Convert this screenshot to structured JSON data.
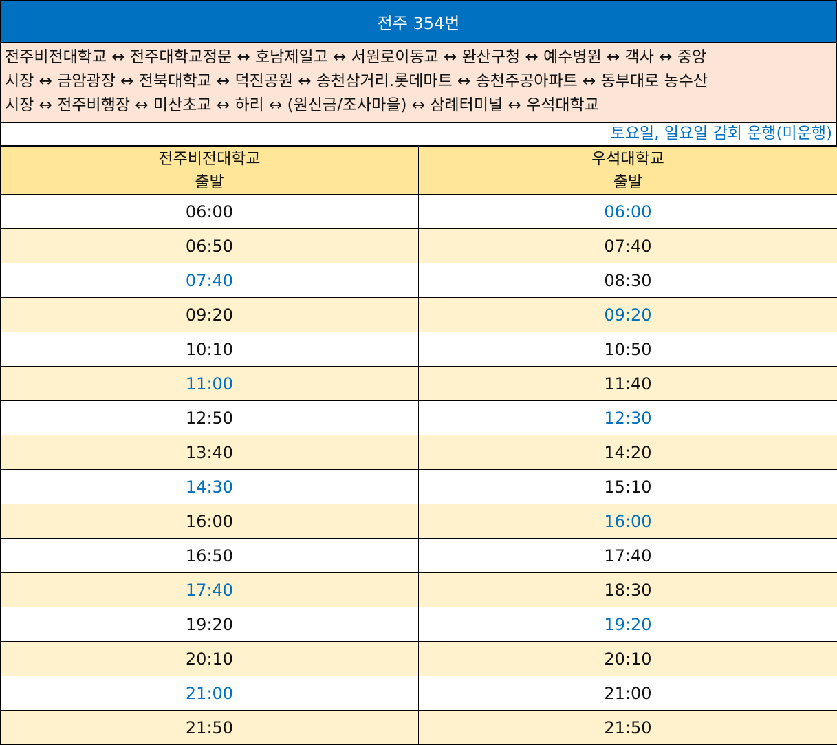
{
  "title": "전주 354번",
  "route_lines": [
    "전주비전대학교 ↔ 전주대학교정문 ↔ 호남제일고 ↔ 서원로이동교 ↔ 완산구청 ↔ 예수병원 ↔ 객사 ↔ 중앙",
    "시장 ↔ 금암광장 ↔ 전북대학교 ↔ 덕진공원 ↔ 송천삼거리.롯데마트 ↔ 송천주공아파트 ↔ 동부대로 농수산",
    "시장 ↔ 전주비행장 ↔ 미산초교 ↔ 하리 ↔ (원신금/조사마을) ↔ 삼례터미널 ↔ 우석대학교"
  ],
  "note": "토요일, 일요일 감회 운행(미운행)",
  "columns": [
    {
      "station": "전주비전대학교",
      "label": "출발"
    },
    {
      "station": "우석대학교",
      "label": "출발"
    }
  ],
  "rows": [
    {
      "left": "06:00",
      "left_hl": false,
      "right": "06:00",
      "right_hl": true
    },
    {
      "left": "06:50",
      "left_hl": false,
      "right": "07:40",
      "right_hl": false
    },
    {
      "left": "07:40",
      "left_hl": true,
      "right": "08:30",
      "right_hl": false
    },
    {
      "left": "09:20",
      "left_hl": false,
      "right": "09:20",
      "right_hl": true
    },
    {
      "left": "10:10",
      "left_hl": false,
      "right": "10:50",
      "right_hl": false
    },
    {
      "left": "11:00",
      "left_hl": true,
      "right": "11:40",
      "right_hl": false
    },
    {
      "left": "12:50",
      "left_hl": false,
      "right": "12:30",
      "right_hl": true
    },
    {
      "left": "13:40",
      "left_hl": false,
      "right": "14:20",
      "right_hl": false
    },
    {
      "left": "14:30",
      "left_hl": true,
      "right": "15:10",
      "right_hl": false
    },
    {
      "left": "16:00",
      "left_hl": false,
      "right": "16:00",
      "right_hl": true
    },
    {
      "left": "16:50",
      "left_hl": false,
      "right": "17:40",
      "right_hl": false
    },
    {
      "left": "17:40",
      "left_hl": true,
      "right": "18:30",
      "right_hl": false
    },
    {
      "left": "19:20",
      "left_hl": false,
      "right": "19:20",
      "right_hl": true
    },
    {
      "left": "20:10",
      "left_hl": false,
      "right": "20:10",
      "right_hl": false
    },
    {
      "left": "21:00",
      "left_hl": true,
      "right": "21:00",
      "right_hl": false
    },
    {
      "left": "21:50",
      "left_hl": false,
      "right": "21:50",
      "right_hl": false
    }
  ],
  "colors": {
    "title_bg": "#0070c0",
    "route_bg": "#fce4d6",
    "header_bg": "#ffe699",
    "stripe_bg": "#fff2cc",
    "highlight_text": "#0070c0"
  }
}
